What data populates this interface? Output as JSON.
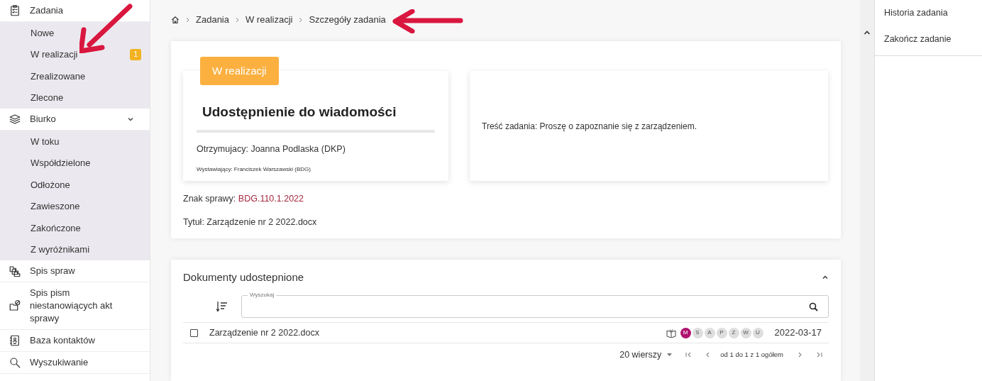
{
  "sidebar": {
    "items": [
      {
        "label": "Zadania",
        "children": [
          {
            "label": "Nowe"
          },
          {
            "label": "W realizacji",
            "badge": "1"
          },
          {
            "label": "Zrealizowane"
          },
          {
            "label": "Zlecone"
          }
        ]
      },
      {
        "label": "Biurko",
        "expanded": true,
        "children": [
          {
            "label": "W toku"
          },
          {
            "label": "Współdzielone"
          },
          {
            "label": "Odłożone"
          },
          {
            "label": "Zawieszone"
          },
          {
            "label": "Zakończone"
          },
          {
            "label": "Z wyróżnikami"
          }
        ]
      },
      {
        "label": "Spis spraw"
      },
      {
        "label": "Spis pism niestanowiących akt sprawy"
      },
      {
        "label": "Baza kontaktów"
      },
      {
        "label": "Wyszukiwanie"
      }
    ]
  },
  "breadcrumb": [
    "Zadania",
    "W realizacji",
    "Szczegóły zadania"
  ],
  "task": {
    "status": "W realizacji",
    "title": "Udostępnienie do wiadomości",
    "recipient": "Otrzymujacy: Joanna Podlaska (DKP)",
    "issuer": "Wystawiający: Franciszek Warszawski (BDG)",
    "content": "Treść zadania: Proszę o zapoznanie się z zarządzeniem.",
    "case_label": "Znak sprawy:",
    "case_number": "BDG.110.1.2022",
    "doc_title": "Tytuł: Zarządzenie nr 2 2022.docx"
  },
  "documents": {
    "title": "Dokumenty udostepnione",
    "expanded": true,
    "search": {
      "label": "Wyszukaj"
    },
    "rows": [
      {
        "name": "Zarządzenie nr 2 2022.docx",
        "checked": false,
        "date": "2022-03-17",
        "tags": [
          {
            "letter": "M",
            "selected": true
          },
          {
            "letter": "S",
            "selected": false
          },
          {
            "letter": "A",
            "selected": false
          },
          {
            "letter": "P",
            "selected": false
          },
          {
            "letter": "Z",
            "selected": false
          },
          {
            "letter": "W",
            "selected": false
          },
          {
            "letter": "U",
            "selected": false
          }
        ]
      }
    ],
    "pagination": {
      "rows_per_page": "20 wierszy",
      "range": "od 1 do 1 z 1 ogółem"
    }
  },
  "actions": [
    "Historia zadania",
    "Zakończ zadanie"
  ]
}
